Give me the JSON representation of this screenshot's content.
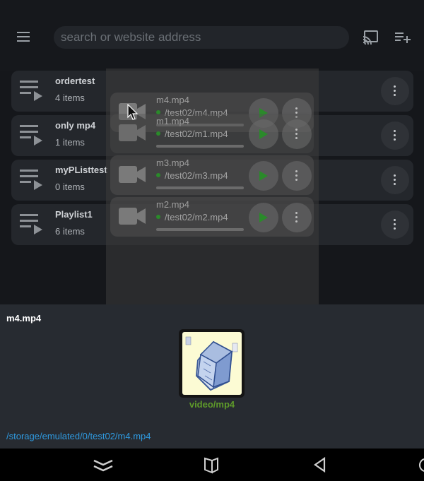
{
  "search": {
    "placeholder": "search or website address"
  },
  "playlists": [
    {
      "name": "ordertest",
      "count": "4 items"
    },
    {
      "name": "only mp4",
      "count": "1 items"
    },
    {
      "name": "myPListtest",
      "count": "0 items"
    },
    {
      "name": "Playlist1",
      "count": "6 items"
    }
  ],
  "media_items": [
    {
      "title": "m4.mp4",
      "path": "/test02/m4.mp4"
    },
    {
      "title": "m1.mp4",
      "path": "/test02/m1.mp4"
    },
    {
      "title": "m3.mp4",
      "path": "/test02/m3.mp4"
    },
    {
      "title": "m2.mp4",
      "path": "/test02/m2.mp4"
    }
  ],
  "detail": {
    "title": "m4.mp4",
    "mime": "video/mp4",
    "path": "/storage/emulated/0/test02/m4.mp4"
  },
  "icons": {
    "menu": "menu-icon",
    "cast": "cast-icon",
    "add_playlist": "playlist-add-icon",
    "playlist": "playlist-play-icon",
    "video": "video-camera-icon",
    "play": "play-icon",
    "more": "more-vertical-icon",
    "nav_recents": "chevron-double-down-icon",
    "nav_home": "home-cube-icon",
    "nav_back": "back-triangle-icon"
  },
  "colors": {
    "accent_blue": "#2f9ae0",
    "mime_green": "#5e9a2a",
    "play_green": "#2a8a2a"
  }
}
